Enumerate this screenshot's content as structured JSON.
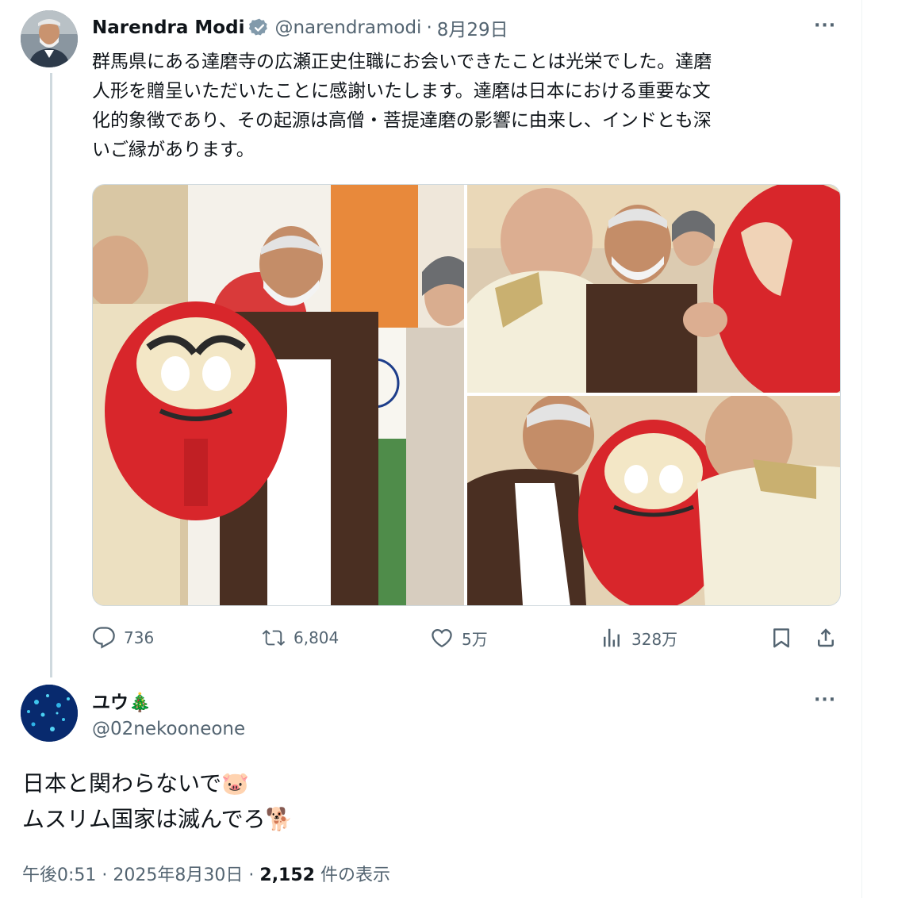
{
  "original_tweet": {
    "author_name": "Narendra Modi",
    "handle": "@narendramodi",
    "separator": "·",
    "date": "8月29日",
    "verified_icon": "verified-badge-icon",
    "more_label": "···",
    "text_lines": [
      "群馬県にある達磨寺の広瀬正史住職にお会いできたことは光栄でした。達磨",
      "人形を贈呈いただいたことに感謝いたします。達磨は日本における重要な文",
      "化的象徴であり、その起源は高僧・菩提達磨の影響に由来し、インドとも深",
      "いご縁があります。"
    ],
    "media_count": 3,
    "actions": {
      "replies": "736",
      "reposts": "6,804",
      "likes": "5万",
      "views": "328万"
    }
  },
  "reply_tweet": {
    "author_name": "ユウ🎄",
    "handle": "@02nekooneone",
    "more_label": "···",
    "text_lines": [
      "日本と関わらないで🐷",
      "ムスリム国家は滅んでろ🐕"
    ],
    "time": "午後0:51",
    "sep1": "·",
    "date": "2025年8月30日",
    "sep2": "·",
    "view_count": "2,152",
    "view_suffix": "件の表示"
  },
  "colors": {
    "text_primary": "#0f1419",
    "text_secondary": "#536471",
    "verified_blue": "#1d9bf0",
    "border": "#cfd9de",
    "daruma_red": "#d8262b"
  }
}
